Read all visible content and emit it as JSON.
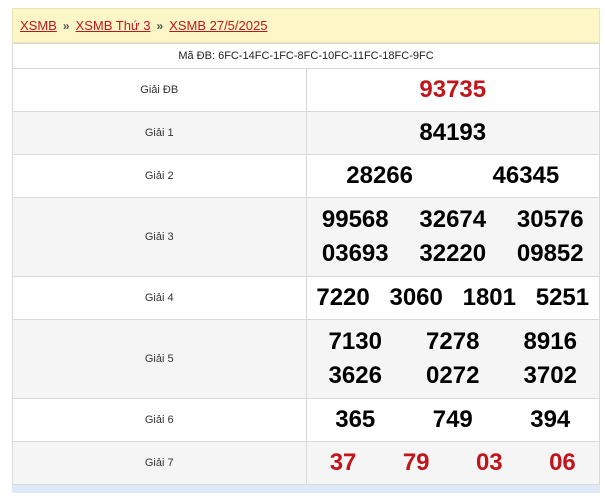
{
  "breadcrumb": {
    "items": [
      "XSMB",
      "XSMB Thứ 3",
      "XSMB 27/5/2025"
    ],
    "separator": "»"
  },
  "code": {
    "label": "Mã ĐB:",
    "value": "6FC-14FC-1FC-8FC-10FC-11FC-18FC-9FC"
  },
  "prizes": {
    "db": {
      "name": "Giải ĐB",
      "numbers": [
        "93735"
      ]
    },
    "g1": {
      "name": "Giải 1",
      "numbers": [
        "84193"
      ]
    },
    "g2": {
      "name": "Giải 2",
      "numbers": [
        "28266",
        "46345"
      ]
    },
    "g3": {
      "name": "Giải 3",
      "numbers": [
        "99568",
        "32674",
        "30576",
        "03693",
        "32220",
        "09852"
      ]
    },
    "g4": {
      "name": "Giải 4",
      "numbers": [
        "7220",
        "3060",
        "1801",
        "5251"
      ]
    },
    "g5": {
      "name": "Giải 5",
      "numbers": [
        "7130",
        "7278",
        "8916",
        "3626",
        "0272",
        "3702"
      ]
    },
    "g6": {
      "name": "Giải 6",
      "numbers": [
        "365",
        "749",
        "394"
      ]
    },
    "g7": {
      "name": "Giải 7",
      "numbers": [
        "37",
        "79",
        "03",
        "06"
      ]
    }
  },
  "colors": {
    "accent_red": "#c0161b",
    "breadcrumb_bg": "#fdf7c8"
  }
}
